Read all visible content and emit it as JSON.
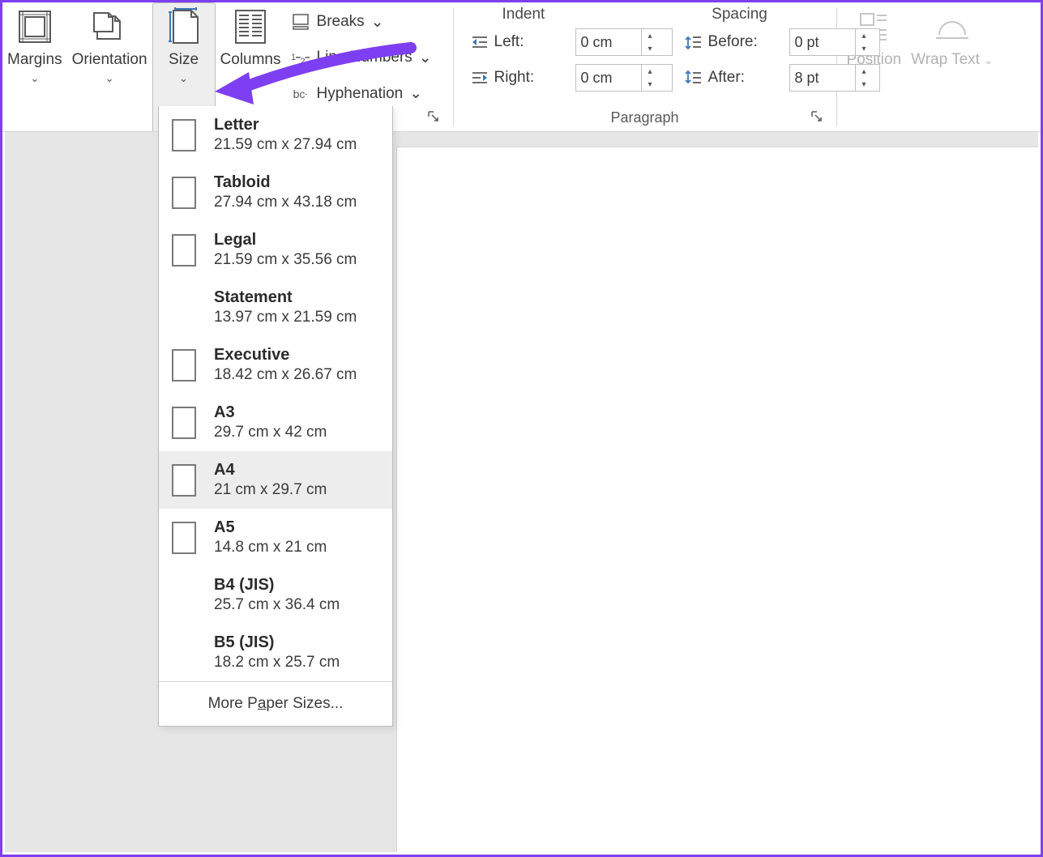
{
  "ribbon": {
    "margins_label": "Margins",
    "orientation_label": "Orientation",
    "size_label": "Size",
    "columns_label": "Columns",
    "breaks_label": "Breaks",
    "linenumbers_label": "Line Numbers",
    "hyphenation_label": "Hyphenation",
    "position_label": "Position",
    "wraptext_label": "Wrap Text"
  },
  "paragraph": {
    "indent_header": "Indent",
    "spacing_header": "Spacing",
    "left_label": "Left:",
    "right_label": "Right:",
    "before_label": "Before:",
    "after_label": "After:",
    "left_value": "0 cm",
    "right_value": "0 cm",
    "before_value": "0 pt",
    "after_value": "8 pt",
    "group_label": "Paragraph"
  },
  "sizes": [
    {
      "name": "Letter",
      "dims": "21.59 cm x 27.94 cm",
      "thumb": true,
      "selected": false
    },
    {
      "name": "Tabloid",
      "dims": "27.94 cm x 43.18 cm",
      "thumb": true,
      "selected": false
    },
    {
      "name": "Legal",
      "dims": "21.59 cm x 35.56 cm",
      "thumb": true,
      "selected": false
    },
    {
      "name": "Statement",
      "dims": "13.97 cm x 21.59 cm",
      "thumb": false,
      "selected": false
    },
    {
      "name": "Executive",
      "dims": "18.42 cm x 26.67 cm",
      "thumb": true,
      "selected": false
    },
    {
      "name": "A3",
      "dims": "29.7 cm x 42 cm",
      "thumb": true,
      "selected": false
    },
    {
      "name": "A4",
      "dims": "21 cm x 29.7 cm",
      "thumb": true,
      "selected": true
    },
    {
      "name": "A5",
      "dims": "14.8 cm x 21 cm",
      "thumb": true,
      "selected": false
    },
    {
      "name": "B4 (JIS)",
      "dims": "25.7 cm x 36.4 cm",
      "thumb": false,
      "selected": false
    },
    {
      "name": "B5 (JIS)",
      "dims": "18.2 cm x 25.7 cm",
      "thumb": false,
      "selected": false
    }
  ],
  "dd_footer_pre": "More P",
  "dd_footer_ul": "a",
  "dd_footer_post": "per Sizes..."
}
